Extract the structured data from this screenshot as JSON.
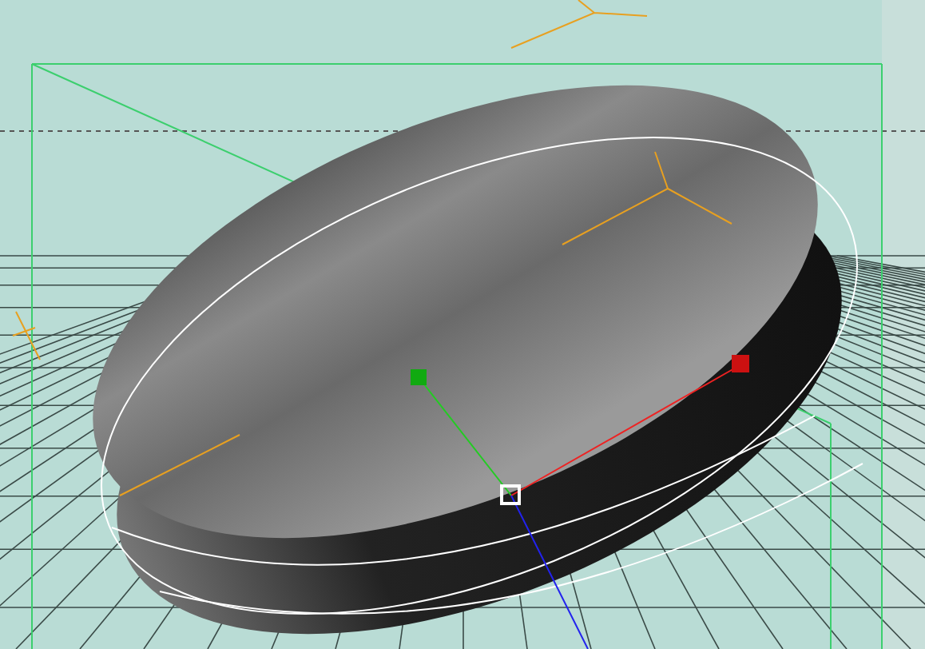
{
  "viewport": {
    "grid_visible": true,
    "manipulator_visible": true
  }
}
